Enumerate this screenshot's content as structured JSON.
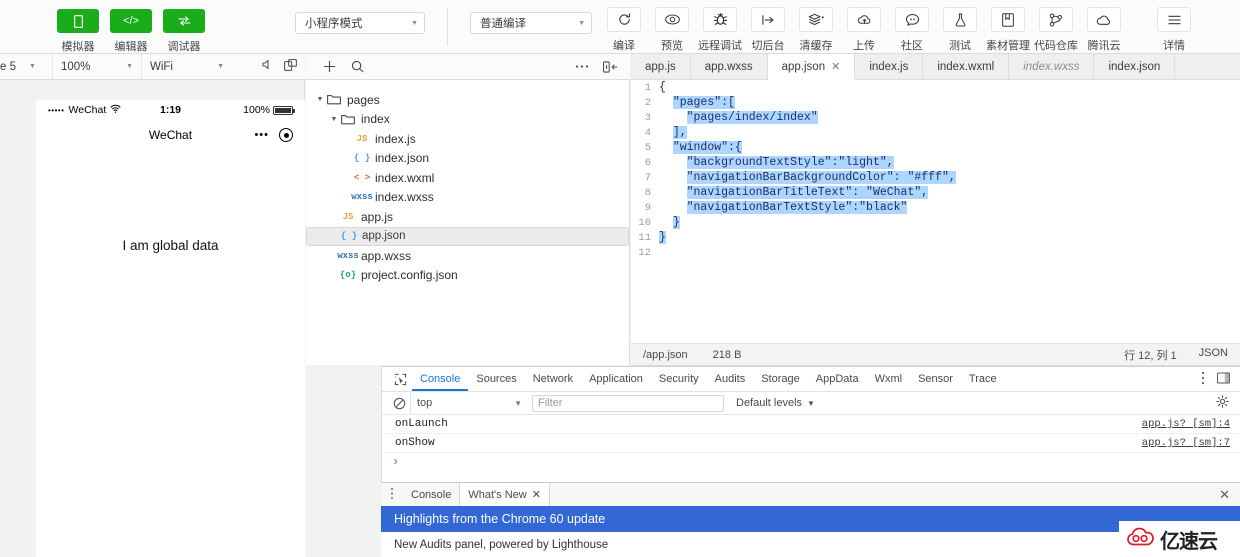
{
  "toolbar": {
    "mode_buttons": [
      {
        "label": "模拟器",
        "icon": "phone-icon"
      },
      {
        "label": "编辑器",
        "icon": "code-icon"
      },
      {
        "label": "调试器",
        "icon": "debug-icon"
      }
    ],
    "mode_select": {
      "value": "小程序模式"
    },
    "compile_select": {
      "value": "普通编译"
    },
    "actions": [
      {
        "label": "编译",
        "icon": "refresh-icon"
      },
      {
        "label": "预览",
        "icon": "eye-icon"
      },
      {
        "label": "远程调试",
        "icon": "bug-icon"
      },
      {
        "label": "切后台",
        "icon": "background-icon"
      },
      {
        "label": "清缓存",
        "icon": "layers-icon"
      },
      {
        "label": "上传",
        "icon": "upload-cloud-icon"
      },
      {
        "label": "社区",
        "icon": "community-icon"
      },
      {
        "label": "测试",
        "icon": "flask-icon"
      },
      {
        "label": "素材管理",
        "icon": "assets-icon"
      },
      {
        "label": "代码仓库",
        "icon": "repo-icon"
      },
      {
        "label": "腾讯云",
        "icon": "cloud-icon"
      }
    ],
    "detail": {
      "label": "详情",
      "icon": "menu-icon"
    }
  },
  "simulator": {
    "device": "e 5",
    "zoom": "100%",
    "network": "WiFi",
    "icons": [
      "volume-icon",
      "rotate-icon"
    ],
    "phone": {
      "signal_dots": "•••••",
      "carrier": "WeChat",
      "wifi_icon": "wifi-icon",
      "time": "1:19",
      "battery_percent": "100%",
      "nav_title": "WeChat",
      "capsule_more": "•••",
      "capsule_target": "target-icon",
      "content": "I am global data"
    }
  },
  "file_panel": {
    "toolbar_icons": [
      "add-icon",
      "search-icon",
      "more-icon",
      "collapse-panel-icon"
    ],
    "tree": [
      {
        "name": "pages",
        "type": "folder",
        "depth": 0,
        "expanded": true,
        "selected": false
      },
      {
        "name": "index",
        "type": "folder",
        "depth": 1,
        "expanded": true,
        "selected": false
      },
      {
        "name": "index.js",
        "type": "js",
        "tag": "JS",
        "depth": 2,
        "selected": false
      },
      {
        "name": "index.json",
        "type": "json",
        "tag": "{ }",
        "depth": 2,
        "selected": false
      },
      {
        "name": "index.wxml",
        "type": "wxml",
        "tag": "< >",
        "depth": 2,
        "selected": false
      },
      {
        "name": "index.wxss",
        "type": "wxss",
        "tag": "wxss",
        "depth": 2,
        "selected": false
      },
      {
        "name": "app.js",
        "type": "js",
        "tag": "JS",
        "depth": 1,
        "selected": false
      },
      {
        "name": "app.json",
        "type": "json",
        "tag": "{ }",
        "depth": 1,
        "selected": true
      },
      {
        "name": "app.wxss",
        "type": "wxss",
        "tag": "wxss",
        "depth": 1,
        "selected": false
      },
      {
        "name": "project.config.json",
        "type": "config",
        "tag": "{o}",
        "depth": 1,
        "selected": false
      }
    ]
  },
  "editor": {
    "tabs": [
      {
        "label": "app.js",
        "active": false,
        "preview": false,
        "closable": false
      },
      {
        "label": "app.wxss",
        "active": false,
        "preview": false,
        "closable": false
      },
      {
        "label": "app.json",
        "active": true,
        "preview": false,
        "closable": true
      },
      {
        "label": "index.js",
        "active": false,
        "preview": false,
        "closable": false
      },
      {
        "label": "index.wxml",
        "active": false,
        "preview": false,
        "closable": false
      },
      {
        "label": "index.wxss",
        "active": false,
        "preview": true,
        "closable": false
      },
      {
        "label": "index.json",
        "active": false,
        "preview": false,
        "closable": false
      }
    ],
    "close_glyph": "✕",
    "lines": [
      {
        "n": "1",
        "indent": 0,
        "text": "{",
        "hl": false
      },
      {
        "n": "2",
        "indent": 1,
        "text": "\"pages\":[",
        "hl": true
      },
      {
        "n": "3",
        "indent": 2,
        "text": "\"pages/index/index\"",
        "hl": true
      },
      {
        "n": "4",
        "indent": 1,
        "text": "],",
        "hl": true
      },
      {
        "n": "5",
        "indent": 1,
        "text": "\"window\":{",
        "hl": true
      },
      {
        "n": "6",
        "indent": 2,
        "text": "\"backgroundTextStyle\":\"light\",",
        "hl": true
      },
      {
        "n": "7",
        "indent": 2,
        "text": "\"navigationBarBackgroundColor\": \"#fff\",",
        "hl": true
      },
      {
        "n": "8",
        "indent": 2,
        "text": "\"navigationBarTitleText\": \"WeChat\",",
        "hl": true
      },
      {
        "n": "9",
        "indent": 2,
        "text": "\"navigationBarTextStyle\":\"black\"",
        "hl": true
      },
      {
        "n": "10",
        "indent": 1,
        "text": "}",
        "hl": true
      },
      {
        "n": "11",
        "indent": 0,
        "text": "}",
        "hl": true
      },
      {
        "n": "12",
        "indent": 0,
        "text": "",
        "hl": false
      }
    ],
    "status": {
      "path": "/app.json",
      "size": "218 B",
      "cursor": "行 12, 列 1",
      "language": "JSON"
    }
  },
  "devtools": {
    "inspect_icon": "inspect-cursor-icon",
    "tabs": [
      {
        "label": "Console",
        "active": true
      },
      {
        "label": "Sources",
        "active": false
      },
      {
        "label": "Network",
        "active": false
      },
      {
        "label": "Application",
        "active": false
      },
      {
        "label": "Security",
        "active": false
      },
      {
        "label": "Audits",
        "active": false
      },
      {
        "label": "Storage",
        "active": false
      },
      {
        "label": "AppData",
        "active": false
      },
      {
        "label": "Wxml",
        "active": false
      },
      {
        "label": "Sensor",
        "active": false
      },
      {
        "label": "Trace",
        "active": false
      }
    ],
    "right_icons": [
      "kebab-menu-icon",
      "dock-icon"
    ],
    "filter_bar": {
      "clear_icon": "clear-console-icon",
      "context": "top",
      "filter_placeholder": "Filter",
      "levels": "Default levels",
      "settings_icon": "gear-icon"
    },
    "console_messages": [
      {
        "text": "onLaunch",
        "source": "app.js? [sm]:4"
      },
      {
        "text": "onShow",
        "source": "app.js? [sm]:7"
      }
    ],
    "prompt": "›"
  },
  "drawer": {
    "kebab_icon": "kebab-menu-icon",
    "tabs": [
      {
        "label": "Console",
        "active": false,
        "closable": false
      },
      {
        "label": "What's New",
        "active": true,
        "closable": true
      }
    ],
    "close_glyph": "✕",
    "banner": "Highlights from the Chrome 60 update",
    "body_text": "New Audits panel, powered by Lighthouse"
  },
  "watermark": {
    "logo": "cloud-logo-icon",
    "text": "亿速云"
  },
  "colors": {
    "brand_green": "#1aad19",
    "accent_blue": "#1976d2",
    "banner_blue": "#3367d6",
    "selection_blue": "#add6ff",
    "watermark_red": "#d81e26"
  }
}
